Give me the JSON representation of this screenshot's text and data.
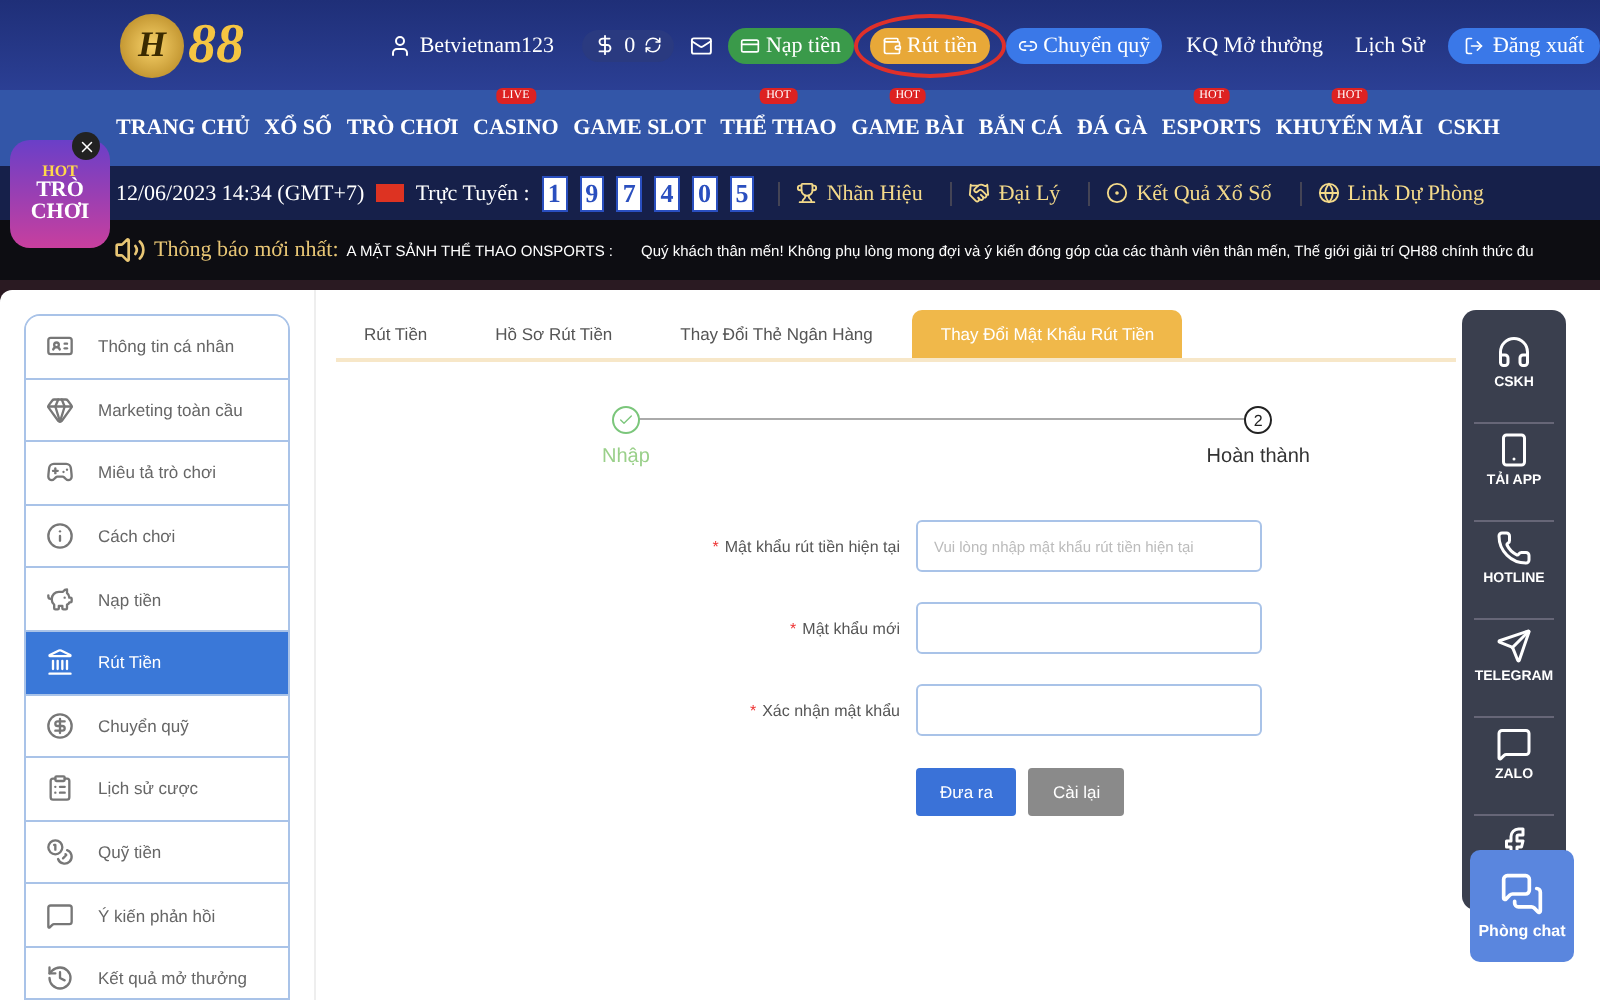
{
  "header": {
    "logo": {
      "letter": "H",
      "number": "88"
    },
    "username": "Betvietnam123",
    "balance": "0",
    "actions": [
      {
        "label": "Nạp tiền",
        "kind": "deposit",
        "circled": false
      },
      {
        "label": "Rút tiền",
        "kind": "withdraw",
        "circled": true
      },
      {
        "label": "Chuyển quỹ",
        "kind": "transfer",
        "circled": false
      }
    ],
    "links": [
      "KQ Mở thưởng",
      "Lịch Sử"
    ],
    "logout": "Đăng xuất"
  },
  "nav": [
    {
      "label": "TRANG CHỦ"
    },
    {
      "label": "XỔ SỐ"
    },
    {
      "label": "TRÒ CHƠI"
    },
    {
      "label": "CASINO",
      "badge": "LIVE"
    },
    {
      "label": "GAME SLOT"
    },
    {
      "label": "THỂ THAO",
      "badge": "HOT"
    },
    {
      "label": "GAME BÀI",
      "badge": "HOT"
    },
    {
      "label": "BẮN CÁ"
    },
    {
      "label": "ĐÁ GÀ"
    },
    {
      "label": "ESPORTS",
      "badge": "HOT"
    },
    {
      "label": "KHUYẾN MÃI",
      "badge": "HOT"
    },
    {
      "label": "CSKH"
    }
  ],
  "promo": {
    "top": "HOT",
    "text": "TRÒ CHƠI"
  },
  "info": {
    "datetime": "12/06/2023 14:34 (GMT+7)",
    "online_label": "Trực Tuyến :",
    "digits": [
      "1",
      "9",
      "7",
      "4",
      "0",
      "5"
    ],
    "links": [
      {
        "label": "Nhãn Hiệu",
        "kind": "trophy"
      },
      {
        "label": "Đại Lý",
        "kind": "handshake"
      },
      {
        "label": "Kết Quả Xổ Số",
        "kind": "ball"
      },
      {
        "label": "Link Dự Phòng",
        "kind": "globe"
      }
    ]
  },
  "notice": {
    "label": "Thông báo mới nhất:",
    "title": "A MẶT SẢNH THỂ THAO ONSPORTS :",
    "text": "Quý khách thân mến! Không phụ lòng mong đợi và ý kiến đóng góp của các thành viên thân mến, Thế giới giải trí QH88 chính thức đu"
  },
  "sidebar": [
    {
      "label": "Thông tin cá nhân",
      "kind": "profile",
      "selected": false
    },
    {
      "label": "Marketing toàn cầu",
      "kind": "gem",
      "selected": false
    },
    {
      "label": "Miêu tả trò chơi",
      "kind": "gamepad",
      "selected": false
    },
    {
      "label": "Cách chơi",
      "kind": "info",
      "selected": false
    },
    {
      "label": "Nạp tiền",
      "kind": "piggy",
      "selected": false
    },
    {
      "label": "Rút Tiền",
      "kind": "withdraw",
      "selected": true
    },
    {
      "label": "Chuyển quỹ",
      "kind": "dollar",
      "selected": false
    },
    {
      "label": "Lịch sử cược",
      "kind": "clipboard",
      "selected": false
    },
    {
      "label": "Quỹ tiền",
      "kind": "coins",
      "selected": false
    },
    {
      "label": "Ý kiến phản hồi",
      "kind": "message",
      "selected": false
    },
    {
      "label": "Kết quả mở thưởng",
      "kind": "history",
      "selected": false
    }
  ],
  "tabs": [
    {
      "label": "Rút Tiền",
      "selected": false
    },
    {
      "label": "Hồ Sơ Rút Tiền",
      "selected": false
    },
    {
      "label": "Thay Đổi Thẻ Ngân Hàng",
      "selected": false
    },
    {
      "label": "Thay Đổi Mật Khẩu Rút Tiền",
      "selected": true
    }
  ],
  "steps": [
    {
      "label": "Nhập",
      "done": true
    },
    {
      "label": "Hoàn thành",
      "done": false,
      "number": "2"
    }
  ],
  "form": {
    "fields": [
      {
        "marker": "*",
        "label": "Mật khẩu rút tiền hiện tại",
        "placeholder": "Vui lòng nhập mật khẩu rút tiền hiện tại"
      },
      {
        "marker": "*",
        "label": "Mật khẩu mới"
      },
      {
        "marker": "*",
        "label": "Xác nhận mật khẩu"
      }
    ],
    "submit": "Đưa ra",
    "reset": "Cài lại"
  },
  "contact": [
    {
      "label": "CSKH",
      "kind": "support"
    },
    {
      "label": "TẢI APP",
      "kind": "phone"
    },
    {
      "label": "HOTLINE",
      "kind": "call"
    },
    {
      "label": "TELEGRAM",
      "kind": "telegram"
    },
    {
      "label": "ZALO",
      "kind": "zalo"
    },
    {
      "kind": "facebook"
    }
  ],
  "chat": "Phòng chat"
}
